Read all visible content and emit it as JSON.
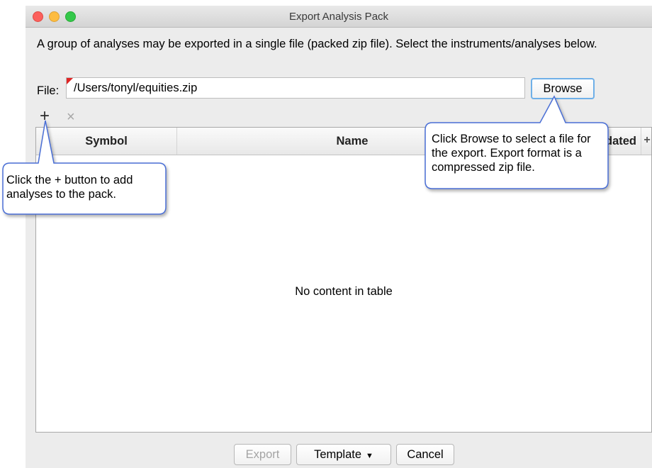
{
  "window": {
    "title": "Export Analysis Pack",
    "description": "A group of analyses may be exported in a single file (packed zip file). Select the instruments/analyses below."
  },
  "file": {
    "label": "File:",
    "value": "/Users/tonyl/equities.zip",
    "browse_label": "Browse"
  },
  "toolbar": {
    "add_glyph": "+",
    "remove_glyph": "×",
    "add_icon": "plus-icon",
    "remove_icon": "close-icon"
  },
  "table": {
    "columns": [
      "Symbol",
      "Name",
      "Updated"
    ],
    "add_column_glyph": "+",
    "empty_text": "No content in table"
  },
  "buttons": {
    "export": "Export",
    "template": "Template",
    "template_caret": "▼",
    "cancel": "Cancel"
  },
  "callouts": {
    "add": "Click the + button to add analyses to the pack.",
    "browse": "Click Browse to select a file for the export.  Export format is a compressed zip file."
  },
  "colors": {
    "callout_border": "#4a6fd6",
    "browse_focus": "#6fb0e8"
  }
}
